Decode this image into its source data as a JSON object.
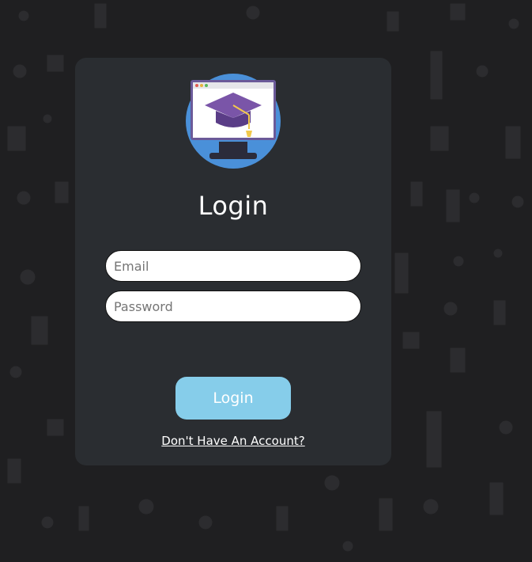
{
  "login": {
    "logo_icon": "graduation-cap-monitor-icon",
    "title": "Login",
    "email_placeholder": "Email",
    "password_placeholder": "Password",
    "submit_label": "Login",
    "signup_link": "Don't Have An Account?"
  },
  "colors": {
    "page_background": "#1f1f21",
    "card_background": "#2a2d31",
    "button_background": "#86cdea",
    "logo_circle": "#4a90d9",
    "cap_purple": "#6b4c9a"
  }
}
